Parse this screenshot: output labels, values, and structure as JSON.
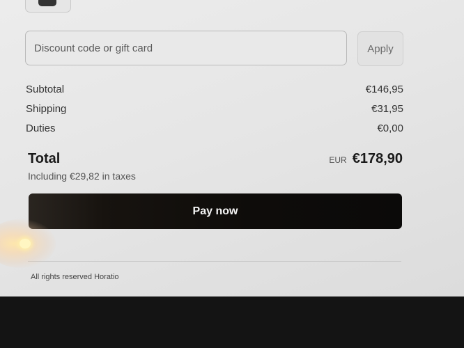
{
  "discount": {
    "placeholder": "Discount code or gift card",
    "apply_label": "Apply"
  },
  "summary": {
    "rows": [
      {
        "label": "Subtotal",
        "amount": "€146,95"
      },
      {
        "label": "Shipping",
        "amount": "€31,95"
      },
      {
        "label": "Duties",
        "amount": "€0,00"
      }
    ],
    "total_label": "Total",
    "currency_code": "EUR",
    "total_amount": "€178,90",
    "taxes_note": "Including €29,82 in taxes"
  },
  "actions": {
    "pay_label": "Pay now"
  },
  "footer": {
    "text": "All rights reserved Horatio"
  }
}
